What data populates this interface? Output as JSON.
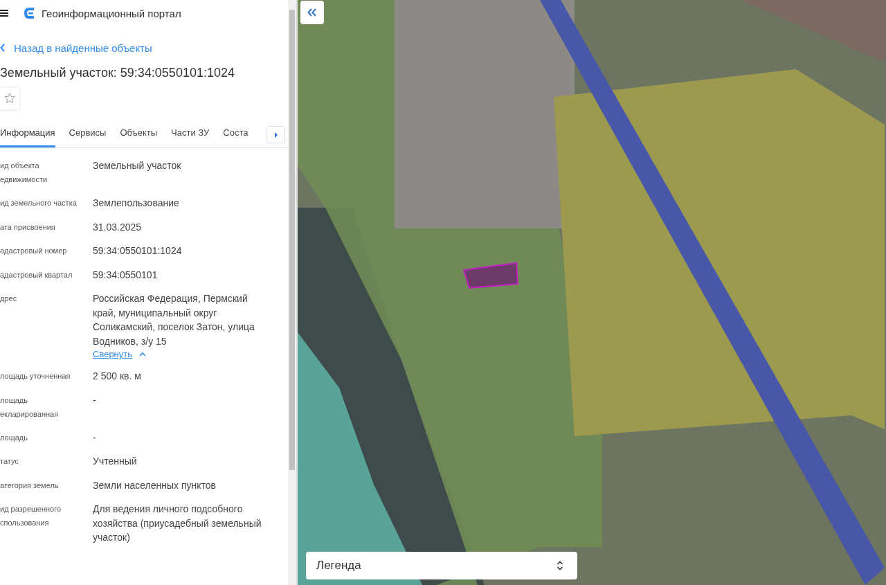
{
  "header": {
    "title": "Геоинформационный портал"
  },
  "back_link": "Назад в найденные объекты",
  "object_title": "Земельный участок: 59:34:0550101:1024",
  "favorite": {
    "selected": false
  },
  "tabs": [
    {
      "label": "Информация",
      "selected": true
    },
    {
      "label": "Сервисы",
      "selected": false
    },
    {
      "label": "Объекты",
      "selected": false
    },
    {
      "label": "Части ЗУ",
      "selected": false
    },
    {
      "label": "Соста",
      "selected": false
    }
  ],
  "fields": [
    {
      "label": "ид объекта едвижимости",
      "value": "Земельный участок"
    },
    {
      "label": "ид земельного частка",
      "value": "Землепользование"
    },
    {
      "label": "ата присвоения",
      "value": "31.03.2025"
    },
    {
      "label": "адастровый номер",
      "value": "59:34:0550101:1024"
    },
    {
      "label": "адастровый квартал",
      "value": "59:34:0550101"
    },
    {
      "label": "дрес",
      "value": "Российская Федерация, Пермский край, муниципальный округ Соликамский, поселок Затон, улица Водников, з/у 15",
      "toggle": "Свернуть",
      "expanded": true
    },
    {
      "label": "лощадь уточненная",
      "value": "2 500 кв. м"
    },
    {
      "label": "лощадь екларированная",
      "value": "-"
    },
    {
      "label": "лощадь",
      "value": "-"
    },
    {
      "label": "татус",
      "value": "Учтенный"
    },
    {
      "label": "атегория земель",
      "value": "Земли населенных пунктов"
    },
    {
      "label": "ид разрешенного спользования",
      "value": "Для ведения личного подсобного хозяйства (приусадебный земельный участок)"
    }
  ],
  "map": {
    "legend": "Легенда"
  }
}
